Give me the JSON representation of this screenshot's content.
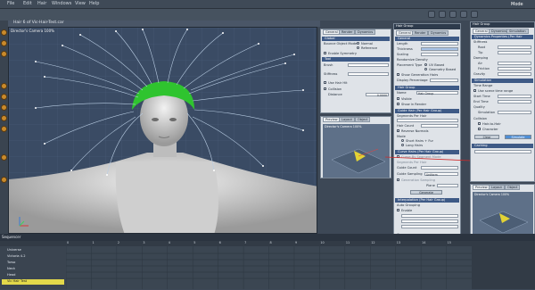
{
  "menu": [
    "File",
    "Edit",
    "Hair",
    "Windows",
    "View",
    "Help"
  ],
  "mode_label": "Mode",
  "viewport": {
    "tab": "Hair 6 of Vic-Hair-Test.car",
    "camera": "Director's Camera 100%"
  },
  "hair_group_panel": {
    "tabs": [
      "General",
      "Render",
      "Dynamics"
    ],
    "global_section": "Global",
    "bounce_object_mode": "Bounce Object Mode",
    "normal": "Normal",
    "reference": "Reference",
    "enable_symmetry": "Enable Symmetry",
    "tool_section": "Tool",
    "brush": "Brush",
    "stiffness": "Stiffness",
    "use_hair_hit": "Use Hair Hit",
    "collision": "Collision",
    "distance": "Distance",
    "distance_value": "0.0000"
  },
  "preview_panel": {
    "tabs": [
      "Preview",
      "Layout",
      "Object"
    ],
    "camera": "Director's Camera 100%"
  },
  "hair_props_panel": {
    "title": "Hair Group",
    "tabs": [
      "General",
      "Render",
      "Dynamics"
    ],
    "general_section": "General",
    "length": "Length",
    "thickness": "Thickness",
    "scaling": "Scaling",
    "randomize_density": "Randomize Density",
    "placement_type": "Placement Type",
    "uv_based": "UV Based",
    "geometry_based": "Geometry Based",
    "show_generation_hairs": "Show Generation Hairs",
    "display_percentage": "Display Percentage",
    "hair_group_section": "Hair Group",
    "name": "Name",
    "name_value": "Hair Group",
    "visible": "Visible",
    "show_in_render": "Show in Render",
    "guide_hair_section": "Guide Hair (Per Hair Group)",
    "segments_per_hair": "Segments Per Hair",
    "hair_count": "Hair Count",
    "reverse_normals": "Reverse Normals",
    "mode": "Mode",
    "short_hairs": "Short Hairs + Fur",
    "long_hairs": "Long Hairs",
    "curve_hairs_section": "Curve Hairs (Per Hair Group)",
    "curve_by_segment_mode": "Curve By Segment Mode",
    "segments_per_hair_2": "Segments Per Hair",
    "guide_count": "Guide Count",
    "guide_sampling": "Guide Sampling",
    "guide_sampling_value": "Uniform",
    "generation_sampling": "Generation Sampling",
    "plane": "Plane",
    "generate_button": "Generate",
    "interpolation_section": "Interpolation (Per Hair Group)",
    "auto_grouping": "Auto Grouping",
    "enable": "Enable",
    "groups": "Groups",
    "reset_groups_button": "Reset Groups"
  },
  "right_panel": {
    "title": "Hair Group",
    "tabs": [
      "General",
      "Dynamics",
      "Simulation"
    ],
    "dynamics_section": "Dynamics Properties (Per Hair Group)",
    "stiffness": "Stiffness",
    "root": "Root",
    "tip": "Tip",
    "damping": "Damping",
    "air": "Air",
    "friction": "Friction",
    "gravity": "Gravity",
    "simulation_section": "Simulation",
    "time_range": "Time Range",
    "use_scene_time_range": "Use scene time range",
    "start_time": "Start Time",
    "end_time": "End Time",
    "quality": "Quality",
    "simulation": "Simulation",
    "collision": "Collision",
    "hair_to_hair": "Hair-to-Hair",
    "character": "Character",
    "clear_button": "Clear",
    "simulate_button": "Simulate",
    "cache_section": "Caching",
    "preview_tabs": [
      "Preview",
      "Layout",
      "Object"
    ],
    "preview_camera": "Director's Camera 100%"
  },
  "timeline": {
    "label": "Sequencer",
    "tracks": [
      "Universe",
      "Victoria 4.2",
      "Torso",
      "Neck",
      "Head",
      "Vic Hair Test"
    ],
    "frame_labels": [
      "0",
      "1",
      "2",
      "3",
      "4",
      "5",
      "6",
      "7",
      "8",
      "9",
      "10",
      "11",
      "12",
      "13",
      "14",
      "15"
    ]
  }
}
